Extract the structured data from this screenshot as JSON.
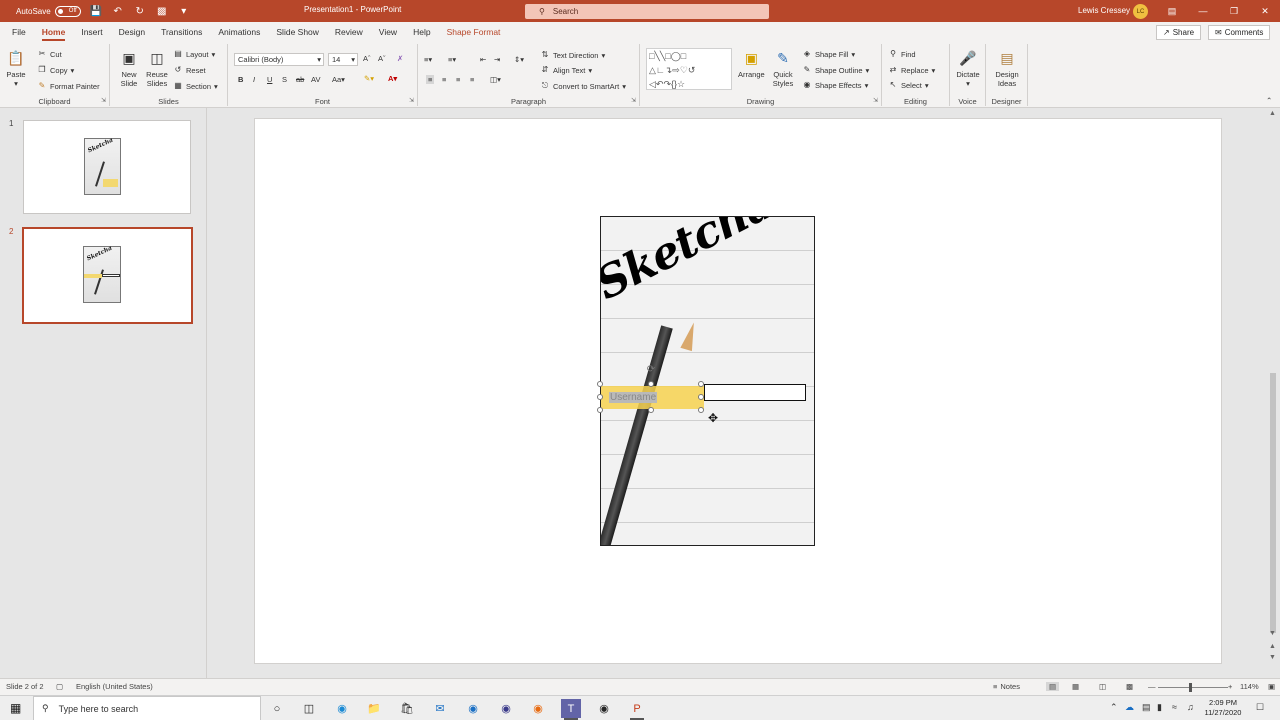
{
  "titlebar": {
    "autosave_label": "AutoSave",
    "autosave_state": "Off",
    "doc_title": "Presentation1  -  PowerPoint",
    "search_placeholder": "Search",
    "user_name": "Lewis Cressey",
    "user_initials": "LC"
  },
  "tabs": [
    "File",
    "Home",
    "Insert",
    "Design",
    "Transitions",
    "Animations",
    "Slide Show",
    "Review",
    "View",
    "Help",
    "Shape Format"
  ],
  "active_tab": "Home",
  "share_label": "Share",
  "comments_label": "Comments",
  "ribbon": {
    "clipboard": {
      "label": "Clipboard",
      "paste": "Paste",
      "cut": "Cut",
      "copy": "Copy",
      "format_painter": "Format Painter"
    },
    "slides": {
      "label": "Slides",
      "new_slide": "New Slide",
      "reuse_slides": "Reuse Slides",
      "layout": "Layout",
      "reset": "Reset",
      "section": "Section"
    },
    "font": {
      "label": "Font",
      "font_name": "Calibri (Body)",
      "font_size": "14"
    },
    "paragraph": {
      "label": "Paragraph",
      "text_direction": "Text Direction",
      "align_text": "Align Text",
      "convert_smartart": "Convert to SmartArt"
    },
    "drawing": {
      "label": "Drawing",
      "arrange": "Arrange",
      "quick_styles": "Quick Styles",
      "shape_fill": "Shape Fill",
      "shape_outline": "Shape Outline",
      "shape_effects": "Shape Effects"
    },
    "editing": {
      "label": "Editing",
      "find": "Find",
      "replace": "Replace",
      "select": "Select"
    },
    "voice": {
      "label": "Voice",
      "dictate": "Dictate"
    },
    "designer": {
      "label": "Designer",
      "design_ideas": "Design Ideas"
    }
  },
  "slides": [
    {
      "number": "1",
      "title": "Sketcha"
    },
    {
      "number": "2",
      "title": "Sketcha"
    }
  ],
  "slide": {
    "poster_title": "Sketcha",
    "username_text": "Username"
  },
  "statusbar": {
    "slide_info": "Slide 2 of 2",
    "language": "English (United States)",
    "notes": "Notes",
    "zoom": "114%"
  },
  "taskbar": {
    "search_placeholder": "Type here to search",
    "time": "2:09 PM",
    "date": "11/27/2020"
  }
}
